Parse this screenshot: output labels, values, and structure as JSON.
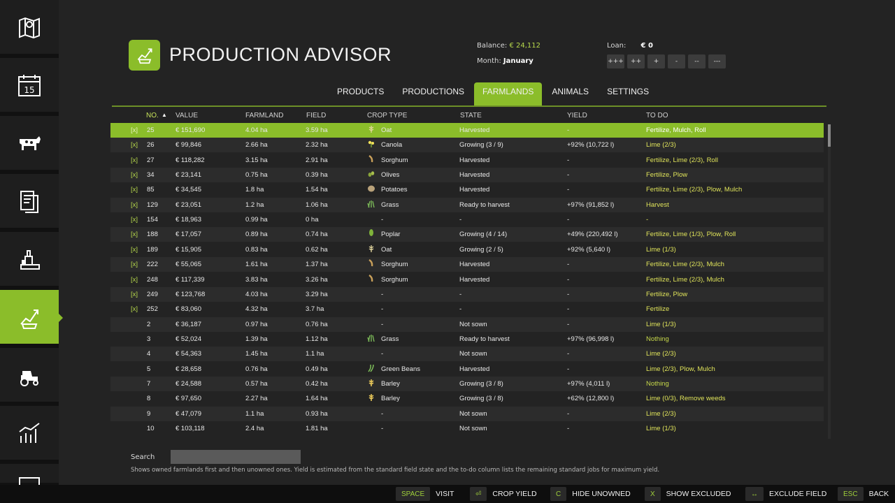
{
  "header": {
    "title": "PRODUCTION ADVISOR",
    "balance_label": "Balance:",
    "balance_value": "€ 24,112",
    "month_label": "Month:",
    "month_value": "January",
    "loan_label": "Loan:",
    "loan_value": "€ 0",
    "loan_buttons": [
      "+++",
      "++",
      "+",
      "-",
      "--",
      "---"
    ]
  },
  "sidebar": {
    "items": [
      {
        "icon": "map-icon"
      },
      {
        "icon": "calendar-icon",
        "label": "15"
      },
      {
        "icon": "cow-icon"
      },
      {
        "icon": "contracts-icon"
      },
      {
        "icon": "production-icon"
      },
      {
        "icon": "advisor-chart-icon",
        "active": true
      },
      {
        "icon": "tractor-icon"
      },
      {
        "icon": "statistics-icon"
      },
      {
        "icon": "screen-icon"
      }
    ]
  },
  "tabs": [
    {
      "label": "PRODUCTS"
    },
    {
      "label": "PRODUCTIONS"
    },
    {
      "label": "FARMLANDS",
      "active": true
    },
    {
      "label": "ANIMALS"
    },
    {
      "label": "SETTINGS"
    }
  ],
  "table": {
    "columns": {
      "no": "NO.",
      "value": "VALUE",
      "farmland": "FARMLAND",
      "field": "FIELD",
      "crop": "CROP TYPE",
      "state": "STATE",
      "yield": "YIELD",
      "todo": "TO DO"
    },
    "rows": [
      {
        "x": "[x]",
        "no": "25",
        "value": "€ 151,690",
        "farmland": "4.04 ha",
        "field": "3.59 ha",
        "icon": "oat",
        "crop": "Oat",
        "state": "Harvested",
        "yield": "-",
        "todo": "Fertilize, Mulch, Roll",
        "selected": true
      },
      {
        "x": "[x]",
        "no": "26",
        "value": "€ 99,846",
        "farmland": "2.66 ha",
        "field": "2.32 ha",
        "icon": "canola",
        "crop": "Canola",
        "state": "Growing (3 / 9)",
        "yield": "+92% (10,722 l)",
        "todo": "Lime (2/3)"
      },
      {
        "x": "[x]",
        "no": "27",
        "value": "€ 118,282",
        "farmland": "3.15 ha",
        "field": "2.91 ha",
        "icon": "sorghum",
        "crop": "Sorghum",
        "state": "Harvested",
        "yield": "-",
        "todo": "Fertilize, Lime (2/3), Roll"
      },
      {
        "x": "[x]",
        "no": "34",
        "value": "€ 23,141",
        "farmland": "0.75 ha",
        "field": "0.39 ha",
        "icon": "olives",
        "crop": "Olives",
        "state": "Harvested",
        "yield": "-",
        "todo": "Fertilize, Plow"
      },
      {
        "x": "[x]",
        "no": "85",
        "value": "€ 34,545",
        "farmland": "1.8 ha",
        "field": "1.54 ha",
        "icon": "potatoes",
        "crop": "Potatoes",
        "state": "Harvested",
        "yield": "-",
        "todo": "Fertilize, Lime (2/3), Plow, Mulch"
      },
      {
        "x": "[x]",
        "no": "129",
        "value": "€ 23,051",
        "farmland": "1.2 ha",
        "field": "1.06 ha",
        "icon": "grass",
        "crop": "Grass",
        "state": "Ready to harvest",
        "yield": "+97% (91,852 l)",
        "todo": "Harvest"
      },
      {
        "x": "[x]",
        "no": "154",
        "value": "€ 18,963",
        "farmland": "0.99 ha",
        "field": "0 ha",
        "icon": "",
        "crop": "-",
        "state": "-",
        "yield": "-",
        "todo": "-"
      },
      {
        "x": "[x]",
        "no": "188",
        "value": "€ 17,057",
        "farmland": "0.89 ha",
        "field": "0.74 ha",
        "icon": "poplar",
        "crop": "Poplar",
        "state": "Growing (4 / 14)",
        "yield": "+49% (220,492 l)",
        "todo": "Fertilize, Lime (1/3), Plow, Roll"
      },
      {
        "x": "[x]",
        "no": "189",
        "value": "€ 15,905",
        "farmland": "0.83 ha",
        "field": "0.62 ha",
        "icon": "oat",
        "crop": "Oat",
        "state": "Growing (2 / 5)",
        "yield": "+92% (5,640 l)",
        "todo": "Lime (1/3)"
      },
      {
        "x": "[x]",
        "no": "222",
        "value": "€ 55,065",
        "farmland": "1.61 ha",
        "field": "1.37 ha",
        "icon": "sorghum",
        "crop": "Sorghum",
        "state": "Harvested",
        "yield": "-",
        "todo": "Fertilize, Lime (2/3), Mulch"
      },
      {
        "x": "[x]",
        "no": "248",
        "value": "€ 117,339",
        "farmland": "3.83 ha",
        "field": "3.26 ha",
        "icon": "sorghum",
        "crop": "Sorghum",
        "state": "Harvested",
        "yield": "-",
        "todo": "Fertilize, Lime (2/3), Mulch"
      },
      {
        "x": "[x]",
        "no": "249",
        "value": "€ 123,768",
        "farmland": "4.03 ha",
        "field": "3.29 ha",
        "icon": "",
        "crop": "-",
        "state": "-",
        "yield": "-",
        "todo": "Fertilize, Plow"
      },
      {
        "x": "[x]",
        "no": "252",
        "value": "€ 83,060",
        "farmland": "4.32 ha",
        "field": "3.7 ha",
        "icon": "",
        "crop": "-",
        "state": "-",
        "yield": "-",
        "todo": "Fertilize"
      },
      {
        "x": "",
        "no": "2",
        "value": "€ 36,187",
        "farmland": "0.97 ha",
        "field": "0.76 ha",
        "icon": "",
        "crop": "-",
        "state": "Not sown",
        "yield": "-",
        "todo": "Lime (1/3)"
      },
      {
        "x": "",
        "no": "3",
        "value": "€ 52,024",
        "farmland": "1.39 ha",
        "field": "1.12 ha",
        "icon": "grass",
        "crop": "Grass",
        "state": "Ready to harvest",
        "yield": "+97% (96,998 l)",
        "todo": "Nothing"
      },
      {
        "x": "",
        "no": "4",
        "value": "€ 54,363",
        "farmland": "1.45 ha",
        "field": "1.1 ha",
        "icon": "",
        "crop": "-",
        "state": "Not sown",
        "yield": "-",
        "todo": "Lime (2/3)"
      },
      {
        "x": "",
        "no": "5",
        "value": "€ 28,658",
        "farmland": "0.76 ha",
        "field": "0.49 ha",
        "icon": "greenbeans",
        "crop": "Green Beans",
        "state": "Harvested",
        "yield": "-",
        "todo": "Lime (2/3), Plow, Mulch"
      },
      {
        "x": "",
        "no": "7",
        "value": "€ 24,588",
        "farmland": "0.57 ha",
        "field": "0.42 ha",
        "icon": "barley",
        "crop": "Barley",
        "state": "Growing (3 / 8)",
        "yield": "+97% (4,011 l)",
        "todo": "Nothing"
      },
      {
        "x": "",
        "no": "8",
        "value": "€ 97,650",
        "farmland": "2.27 ha",
        "field": "1.64 ha",
        "icon": "barley",
        "crop": "Barley",
        "state": "Growing (3 / 8)",
        "yield": "+62% (12,800 l)",
        "todo": "Lime (0/3), Remove weeds"
      },
      {
        "x": "",
        "no": "9",
        "value": "€ 47,079",
        "farmland": "1.1 ha",
        "field": "0.93 ha",
        "icon": "",
        "crop": "-",
        "state": "Not sown",
        "yield": "-",
        "todo": "Lime (2/3)"
      },
      {
        "x": "",
        "no": "10",
        "value": "€ 103,118",
        "farmland": "2.4 ha",
        "field": "1.81 ha",
        "icon": "",
        "crop": "-",
        "state": "Not sown",
        "yield": "-",
        "todo": "Lime (1/3)"
      }
    ]
  },
  "search": {
    "label": "Search",
    "value": "",
    "hint": "Shows owned farmlands first and then unowned ones. Yield is estimated from the standard field state and the to-do column lists the remaining standard jobs for maximum yield."
  },
  "hotkeys": [
    {
      "key": "SPACE",
      "label": "VISIT"
    },
    {
      "key": "⏎",
      "label": "CROP YIELD"
    },
    {
      "key": "C",
      "label": "HIDE UNOWNED"
    },
    {
      "key": "X",
      "label": "SHOW EXCLUDED"
    },
    {
      "key": "↔",
      "label": "EXCLUDE FIELD"
    },
    {
      "key": "ESC",
      "label": "BACK"
    }
  ],
  "colors": {
    "accent": "#8bbd2a",
    "background": "#232323",
    "todo": "#dfe35a"
  }
}
